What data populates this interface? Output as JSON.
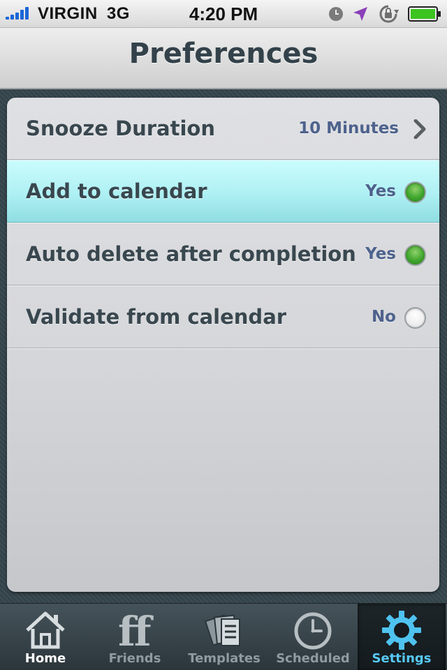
{
  "status_bar": {
    "carrier": "VIRGIN",
    "network": "3G",
    "time": "4:20 PM",
    "icons": [
      "clock-icon",
      "location-arrow-icon",
      "rotation-lock-icon",
      "battery-icon"
    ],
    "signal_color": "#1a66d6",
    "battery_color": "#3cc421"
  },
  "nav_bar": {
    "title": "Preferences"
  },
  "settings": {
    "rows": [
      {
        "label": "Snooze Duration",
        "value": "10 Minutes",
        "control": "chevron-right-icon",
        "selected": false
      },
      {
        "label": "Add to calendar",
        "value": "Yes",
        "control": "toggle-on",
        "selected": true
      },
      {
        "label": "Auto delete after completion",
        "value": "Yes",
        "control": "toggle-on",
        "selected": false
      },
      {
        "label": "Validate from calendar",
        "value": "No",
        "control": "toggle-off",
        "selected": false
      }
    ],
    "value_color": "#4d628c",
    "selected_color": "#aef0f3"
  },
  "tab_bar": {
    "tabs": [
      {
        "label": "Home",
        "icon": "home-icon"
      },
      {
        "label": "Friends",
        "icon": "friends-ff-icon"
      },
      {
        "label": "Templates",
        "icon": "templates-icon"
      },
      {
        "label": "Scheduled",
        "icon": "clock-icon"
      },
      {
        "label": "Settings",
        "icon": "gear-icon"
      }
    ],
    "active_tab": "Settings",
    "active_color": "#57c9f5"
  }
}
